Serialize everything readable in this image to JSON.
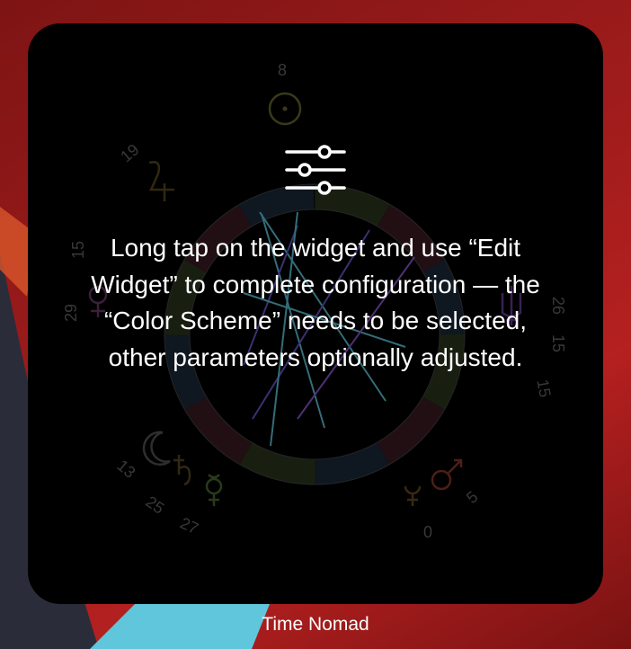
{
  "widget": {
    "message": "Long tap on the widget and use “Edit Widget” to complete configuration — the “Color Scheme” needs to be selected, other parameters optionally adjusted.",
    "settings_icon": "sliders-icon",
    "chart_numbers": {
      "top": "8",
      "left_top": "19",
      "left_15": "15",
      "left_29": "29",
      "left_13": "13",
      "left_25": "25",
      "left_27": "27",
      "right_26": "26",
      "right_15a": "15",
      "right_15b": "15",
      "right_5": "5",
      "bottom_0": "0"
    }
  },
  "app": {
    "name": "Time Nomad"
  },
  "colors": {
    "wallpaper_red": "#a01c1c",
    "widget_bg": "#000000",
    "text": "#ffffff",
    "accent_cyan": "#5fc6dc"
  }
}
